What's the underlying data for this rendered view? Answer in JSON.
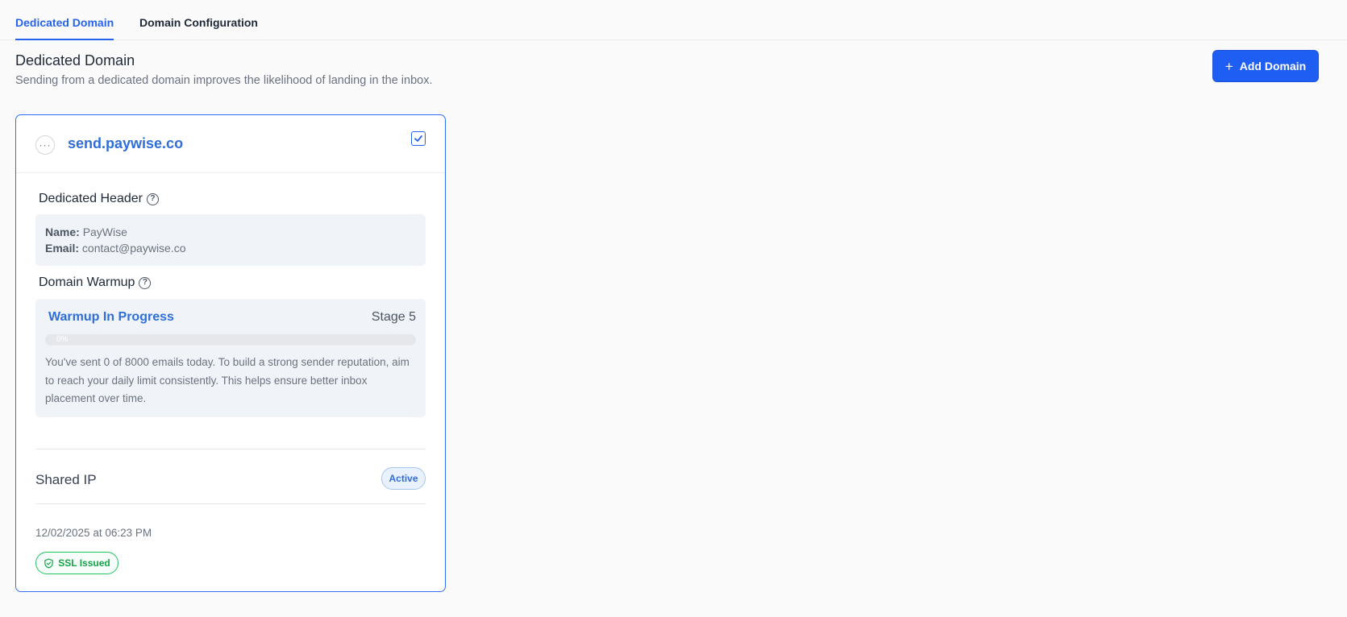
{
  "tabs": [
    {
      "label": "Dedicated Domain",
      "active": true
    },
    {
      "label": "Domain Configuration",
      "active": false
    }
  ],
  "page": {
    "title": "Dedicated Domain",
    "subtitle": "Sending from a dedicated domain improves the likelihood of landing in the inbox.",
    "add_button_label": "Add Domain",
    "add_button_icon": "plus-icon"
  },
  "domain_card": {
    "domain": "send.paywise.co",
    "selected": true,
    "dedicated_header": {
      "label": "Dedicated Header",
      "name_label": "Name:",
      "name_value": "PayWise",
      "email_label": "Email:",
      "email_value": "contact@paywise.co"
    },
    "warmup": {
      "label": "Domain Warmup",
      "status": "Warmup In Progress",
      "stage": "Stage 5",
      "progress_percent": 0,
      "progress_text": "0%",
      "description": "You've sent 0 of 8000 emails today. To build a strong sender reputation, aim to reach your daily limit consistently. This helps ensure better inbox placement over time."
    },
    "ip": {
      "label": "Shared IP",
      "status": "Active"
    },
    "created": "12/02/2025 at 06:23 PM",
    "ssl_status": "SSL Issued"
  },
  "colors": {
    "accent": "#2563eb",
    "success": "#16a34a",
    "background": "#fafafa"
  }
}
